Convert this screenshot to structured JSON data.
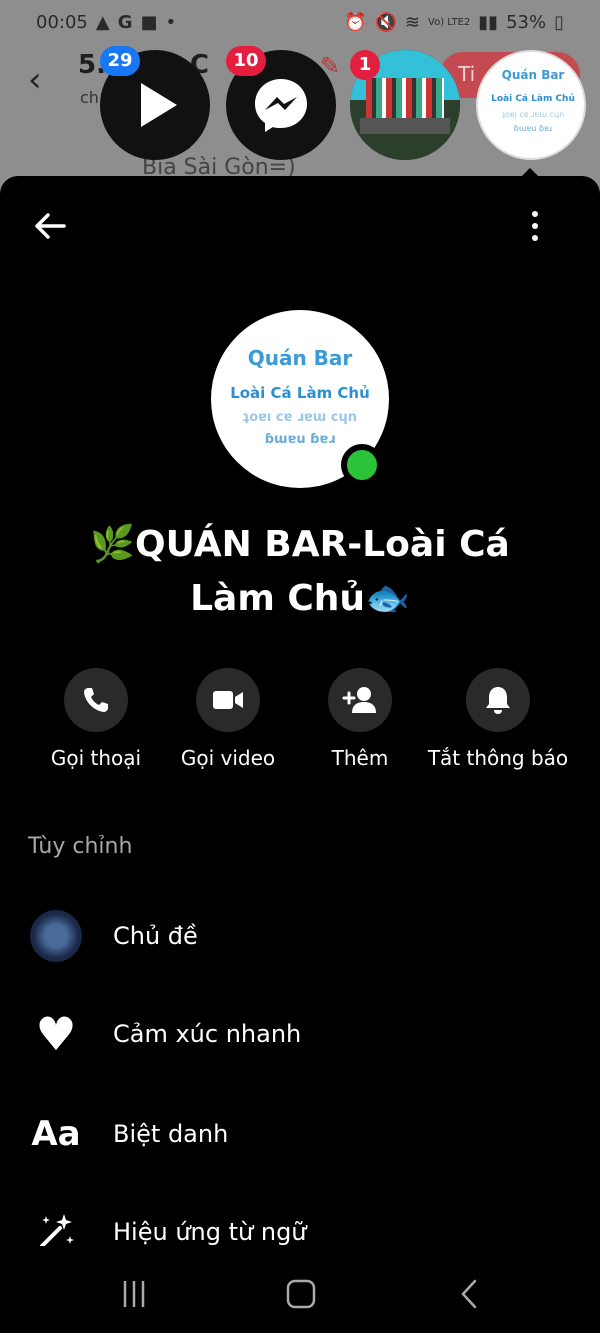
{
  "status_bar": {
    "time": "00:05",
    "network": "Vo) LTE2",
    "battery": "53%"
  },
  "background": {
    "title": "5. ...ều C",
    "subtitle": "ch",
    "button": "Ti",
    "text1": "g",
    "text2": "Bia Sài Gòn=)"
  },
  "chat_heads": {
    "video_badge": "29",
    "messenger_badge": "10",
    "group1_badge": "1"
  },
  "avatar": {
    "line1": "Quán Bar",
    "line2": "Loài Cá Làm Chủ",
    "line3": "ʇoɐı cɐ ɹɐɯ cɥn",
    "line4": "ɓɯɐu ɓɐɹ"
  },
  "group_name": "🌿QUÁN BAR-Loài Cá Làm Chủ🐟",
  "actions": [
    {
      "label": "Gọi thoại",
      "icon": "phone-icon"
    },
    {
      "label": "Gọi video",
      "icon": "video-camera-icon"
    },
    {
      "label": "Thêm",
      "icon": "add-person-icon"
    },
    {
      "label": "Tắt thông báo",
      "icon": "bell-icon"
    }
  ],
  "customize": {
    "section_label": "Tùy chỉnh",
    "items": [
      {
        "label": "Chủ đề",
        "icon": "theme-icon"
      },
      {
        "label": "Cảm xúc nhanh",
        "icon": "heart-icon"
      },
      {
        "label": "Biệt danh",
        "icon": "nickname-icon",
        "icon_text": "Aa"
      },
      {
        "label": "Hiệu ứng từ ngữ",
        "icon": "sparkle-wand-icon"
      }
    ]
  },
  "colors": {
    "online": "#2ac43a",
    "badge_blue": "#1877f2",
    "badge_red": "#e41e3f",
    "action_bg": "#2a2a2a"
  }
}
